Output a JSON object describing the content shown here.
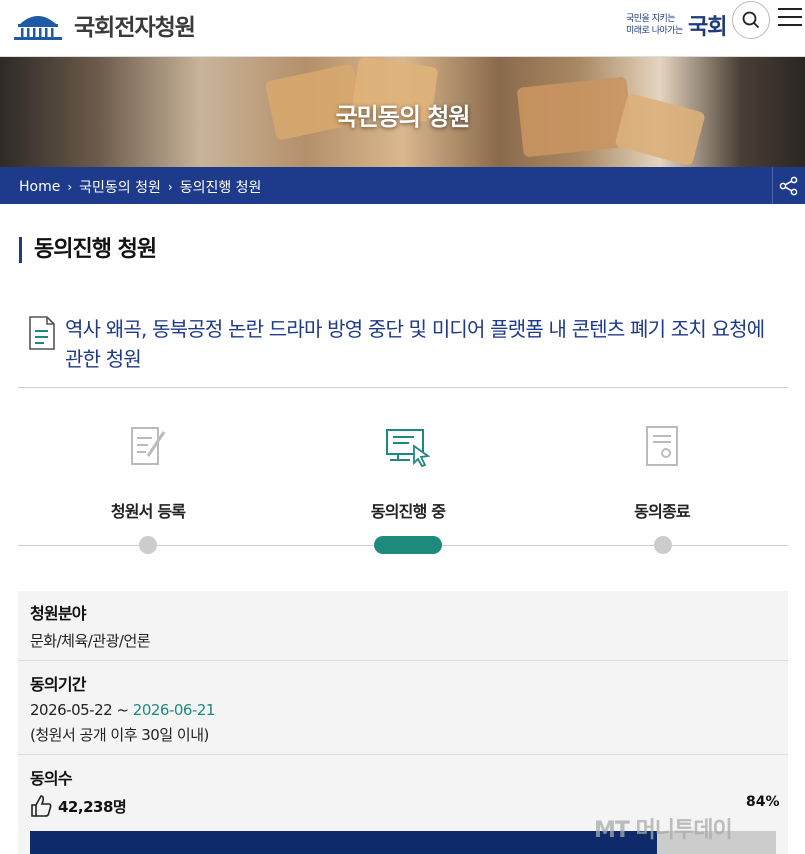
{
  "header": {
    "site_title": "국회전자청원",
    "slogan_line1": "국민을 지키는",
    "slogan_line2": "미래로 나아가는",
    "slogan_big": "국회",
    "icons": {
      "logo": "assembly-building-icon",
      "search": "search-icon",
      "menu": "hamburger-menu-icon"
    }
  },
  "banner": {
    "title": "국민동의 청원"
  },
  "breadcrumb": {
    "items": [
      "Home",
      "국민동의 청원",
      "동의진행 청원"
    ],
    "share_icon": "share-icon"
  },
  "page_title": "동의진행 청원",
  "petition": {
    "title": "역사 왜곡, 동북공정 논란 드라마 방영 중단 및 미디어 플랫폼 내 콘텐츠 폐기 조치 요청에 관한 청원"
  },
  "steps": [
    {
      "label": "청원서 등록",
      "icon": "document-pen-icon",
      "active": false
    },
    {
      "label": "동의진행 중",
      "icon": "computer-click-icon",
      "active": true
    },
    {
      "label": "동의종료",
      "icon": "certificate-icon",
      "active": false
    }
  ],
  "info": {
    "field_label": "청원분야",
    "field_value": "문화/체육/관광/언론",
    "period_label": "동의기간",
    "period_start": "2026-05-22 ~ ",
    "period_end": "2026-06-21",
    "period_note": "(청원서 공개 이후 30일 이내)",
    "count_label": "동의수",
    "count_value": "42,238명",
    "percent_label": "84%",
    "progress_fraction": 0.84
  },
  "watermark": "MT 머니투데이",
  "colors": {
    "navy": "#1e3a8a",
    "teal": "#1e8a7e",
    "bar": "#0e2a6b"
  }
}
